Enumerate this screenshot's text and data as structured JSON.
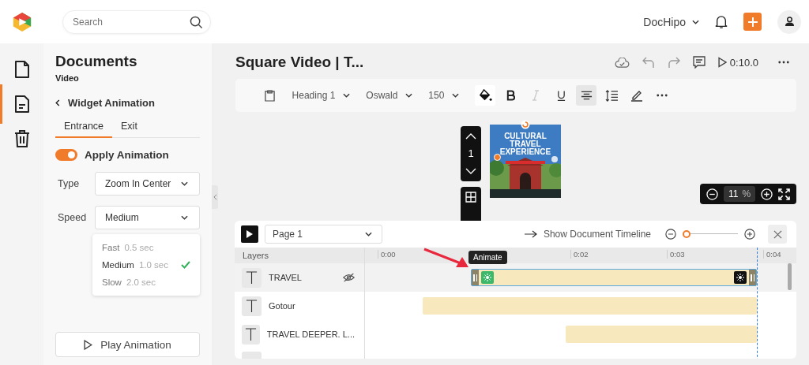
{
  "header": {
    "search": {
      "placeholder": "Search"
    },
    "workspace": "DocHipo"
  },
  "rail": [
    {
      "kind": "document",
      "selected": false
    },
    {
      "kind": "page",
      "selected": true
    },
    {
      "kind": "trash",
      "selected": false
    }
  ],
  "panel": {
    "title": "Documents",
    "subtitle": "Video",
    "back_label": "Widget Animation",
    "tabs": [
      {
        "label": "Entrance",
        "selected": true
      },
      {
        "label": "Exit",
        "selected": false
      }
    ],
    "apply_animation": {
      "label": "Apply Animation",
      "on": true
    },
    "type": {
      "label": "Type",
      "value": "Zoom In Center"
    },
    "speed": {
      "label": "Speed",
      "value": "Medium",
      "options": [
        {
          "name": "Fast",
          "duration": "0.5 sec",
          "selected": false
        },
        {
          "name": "Medium",
          "duration": "1.0 sec",
          "selected": true
        },
        {
          "name": "Slow",
          "duration": "2.0 sec",
          "selected": false
        }
      ]
    },
    "play_button": "Play Animation"
  },
  "document": {
    "title": "Square Video | T...",
    "duration": "0:10.0"
  },
  "toolbar": {
    "style": "Heading 1",
    "font": "Oswald",
    "size": "150",
    "italic": {
      "disabled": true
    },
    "align_center": {
      "selected": true
    }
  },
  "canvas": {
    "page_number": "1",
    "thumbnail_title": [
      "CULTURAL",
      "TRAVEL",
      "EXPERIENCE"
    ],
    "zoom": "11",
    "zoom_unit": "%"
  },
  "timeline": {
    "page": "Page 1",
    "document_timeline": "Show Document Timeline",
    "zoom_slider": {
      "level": 0
    },
    "layers_heading": "Layers",
    "ticks": [
      "0:00",
      "0:02",
      "0:03",
      "0:04"
    ],
    "tooltip": "Animate",
    "layers": [
      {
        "name": "TRAVEL",
        "selected": true,
        "hidden": true
      },
      {
        "name": "Gotour",
        "selected": false,
        "hidden": false
      },
      {
        "name": "TRAVEL DEEPER. L...",
        "selected": false,
        "hidden": false
      }
    ]
  }
}
